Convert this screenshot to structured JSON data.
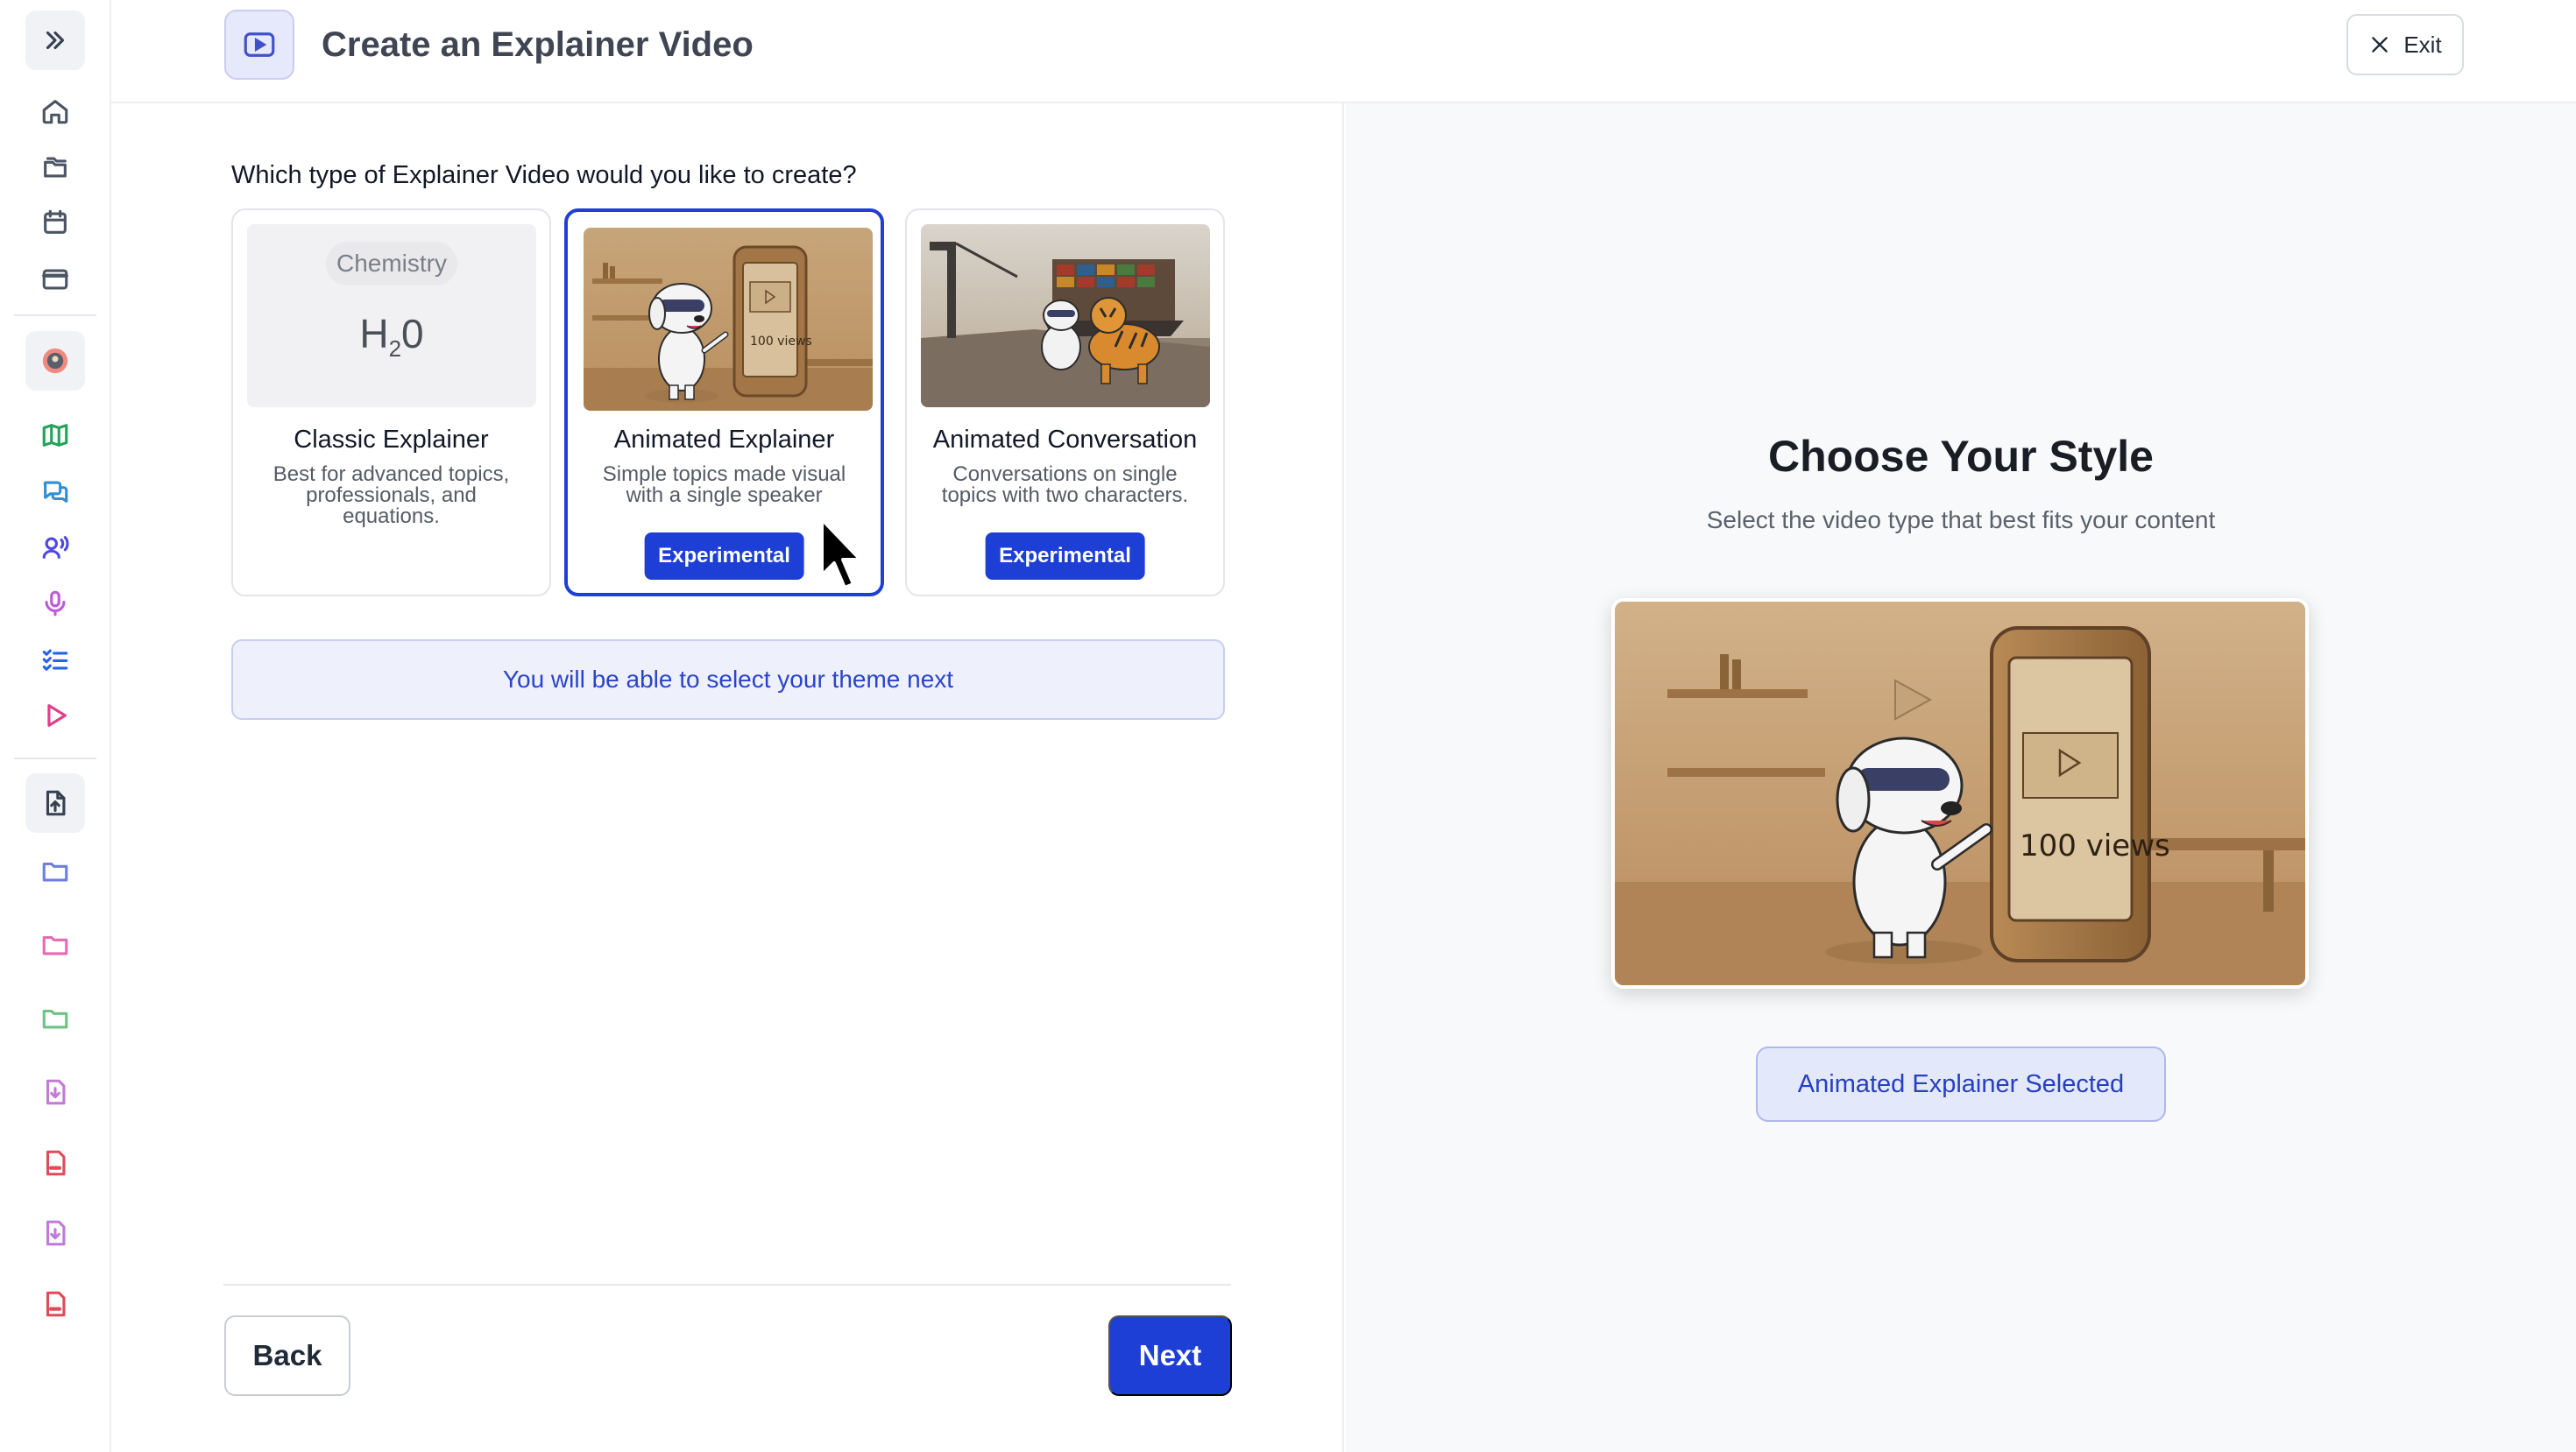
{
  "header": {
    "title": "Create an Explainer Video",
    "exit_label": "Exit",
    "icon": "video-play-icon"
  },
  "sidebar": {
    "items": [
      {
        "icon": "chevrons-right-icon"
      },
      {
        "icon": "home-icon"
      },
      {
        "icon": "folders-icon"
      },
      {
        "icon": "calendar-icon"
      },
      {
        "icon": "browser-window-icon"
      },
      {
        "icon": "avatar-icon"
      },
      {
        "icon": "map-icon"
      },
      {
        "icon": "chat-bubbles-icon"
      },
      {
        "icon": "speaker-user-icon"
      },
      {
        "icon": "microphone-icon"
      },
      {
        "icon": "checklist-icon"
      },
      {
        "icon": "play-icon"
      },
      {
        "icon": "upload-file-icon"
      },
      {
        "icon": "folder-blue-icon"
      },
      {
        "icon": "folder-pink-icon"
      },
      {
        "icon": "folder-green-icon"
      },
      {
        "icon": "file-download-icon"
      },
      {
        "icon": "pdf-file-icon"
      },
      {
        "icon": "file-download-icon"
      },
      {
        "icon": "pdf-file-icon"
      }
    ]
  },
  "main": {
    "question": "Which type of Explainer Video would you like to create?",
    "cards": [
      {
        "thumb_label": "Chemistry",
        "thumb_formula_main": "H",
        "thumb_formula_sub": "2",
        "thumb_formula_end": "0",
        "title": "Classic Explainer",
        "desc": "Best for advanced topics, professionals, and equations."
      },
      {
        "title": "Animated Explainer",
        "desc": "Simple topics made visual with a single speaker",
        "badge": "Experimental",
        "thumb_views": "100 views",
        "selected": true
      },
      {
        "title": "Animated Conversation",
        "desc": "Conversations on single topics with two characters.",
        "badge": "Experimental"
      }
    ],
    "theme_note": "You will be able to select your theme next",
    "back_label": "Back",
    "next_label": "Next"
  },
  "preview": {
    "title": "Choose Your Style",
    "subtitle": "Select the video type that best fits your content",
    "views": "100 views",
    "selected_label": "Animated Explainer Selected"
  },
  "colors": {
    "accent": "#1d3fd6",
    "note_bg": "#eef0fc",
    "panel_bg": "#f8f9fa"
  }
}
